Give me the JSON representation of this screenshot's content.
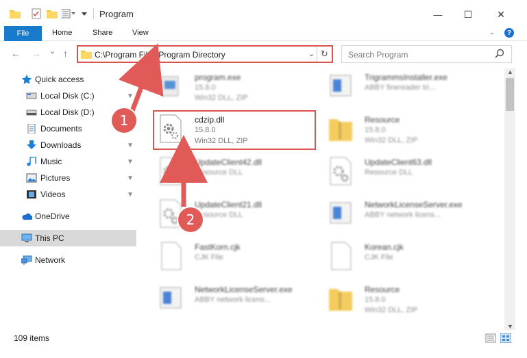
{
  "window": {
    "title": "Program",
    "minimize_glyph": "—",
    "maximize_glyph": "☐",
    "close_glyph": "✕"
  },
  "ribbon": {
    "file_tab": "File",
    "home_tab": "Home",
    "share_tab": "Share",
    "view_tab": "View",
    "help_glyph": "?"
  },
  "navigation": {
    "back_glyph": "←",
    "forward_glyph": "→",
    "recent_glyph": "⌄",
    "up_glyph": "↑",
    "address": "C:\\Program Files\\Program Directory",
    "address_dropdown_glyph": "⌄",
    "refresh_glyph": "↻",
    "search_placeholder": "Search Program"
  },
  "sidebar": {
    "items": [
      {
        "label": "Quick access",
        "icon": "star-icon",
        "pinned": false
      },
      {
        "label": "Local Disk (C:)",
        "icon": "drive-icon",
        "pinned": true
      },
      {
        "label": "Local Disk (D:)",
        "icon": "drive-icon",
        "pinned": true
      },
      {
        "label": "Documents",
        "icon": "documents-icon",
        "pinned": true
      },
      {
        "label": "Downloads",
        "icon": "download-icon",
        "pinned": true
      },
      {
        "label": "Music",
        "icon": "music-icon",
        "pinned": true
      },
      {
        "label": "Pictures",
        "icon": "pictures-icon",
        "pinned": true
      },
      {
        "label": "Videos",
        "icon": "videos-icon",
        "pinned": true
      },
      {
        "label": "OneDrive",
        "icon": "cloud-icon",
        "pinned": false
      },
      {
        "label": "This PC",
        "icon": "computer-icon",
        "pinned": false,
        "selected": true
      },
      {
        "label": "Network",
        "icon": "network-icon",
        "pinned": false
      }
    ],
    "pin_glyph": "📌"
  },
  "files": [
    {
      "name": "program.exe",
      "line1": "15.8.0",
      "line2": "Win32 DLL, ZIP",
      "icon": "exe-icon",
      "blurred": true
    },
    {
      "name": "TrigrammsInstaller.exe",
      "line1": "ABBY finereader tri...",
      "line2": "",
      "icon": "exe-icon",
      "blurred": true
    },
    {
      "name": "cdzip.dll",
      "line1": "15.8.0",
      "line2": "Win32 DLL, ZIP",
      "icon": "dll-gear-icon",
      "blurred": false
    },
    {
      "name": "Resource",
      "line1": "15.8.0",
      "line2": "Win32 DLL, ZIP",
      "icon": "folder-zip-icon",
      "blurred": true
    },
    {
      "name": "UpdateClient42.dll",
      "line1": "Resource DLL",
      "line2": "",
      "icon": "dll-gear-icon",
      "blurred": true
    },
    {
      "name": "UpdateClient63.dll",
      "line1": "Resource DLL",
      "line2": "",
      "icon": "dll-gear-icon",
      "blurred": true
    },
    {
      "name": "UpdateClient21.dll",
      "line1": "Resource DLL",
      "line2": "",
      "icon": "dll-gear-icon",
      "blurred": true
    },
    {
      "name": "NetworkLicenseServer.exe",
      "line1": "ABBY network licens...",
      "line2": "",
      "icon": "exe-icon",
      "blurred": true
    },
    {
      "name": "FastKorn.cjk",
      "line1": "CJK File",
      "line2": "",
      "icon": "blank-file-icon",
      "blurred": true
    },
    {
      "name": "Korean.cjk",
      "line1": "CJK File",
      "line2": "",
      "icon": "blank-file-icon",
      "blurred": true
    },
    {
      "name": "NetworkLicenseServer.exe",
      "line1": "ABBY network licens...",
      "line2": "",
      "icon": "exe-icon",
      "blurred": true
    },
    {
      "name": "Resource",
      "line1": "15.8.0",
      "line2": "Win32 DLL, ZIP",
      "icon": "folder-zip-icon",
      "blurred": true
    }
  ],
  "annotations": {
    "step1": "1",
    "step2": "2",
    "color": "#e05a57"
  },
  "status": {
    "item_count": "109 items"
  },
  "colors": {
    "accent": "#1979ca",
    "highlight": "#d9534f",
    "selected_bg": "#d9d9d9"
  }
}
